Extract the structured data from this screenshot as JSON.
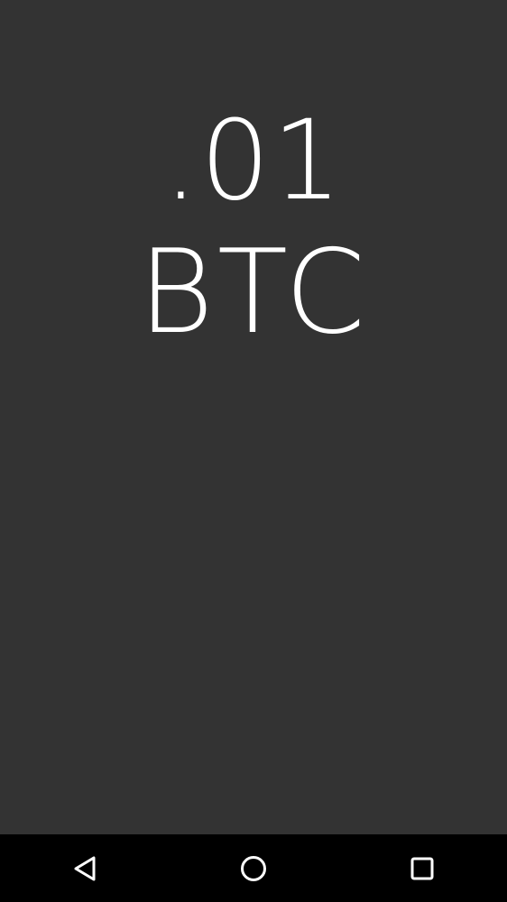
{
  "display": {
    "amount": ".01",
    "currency": "BTC"
  },
  "navbar": {
    "back_icon": "back-triangle-icon",
    "home_icon": "home-circle-icon",
    "recents_icon": "recents-square-icon"
  },
  "colors": {
    "background": "#333333",
    "text": "#ffffff",
    "navbar": "#000000"
  }
}
